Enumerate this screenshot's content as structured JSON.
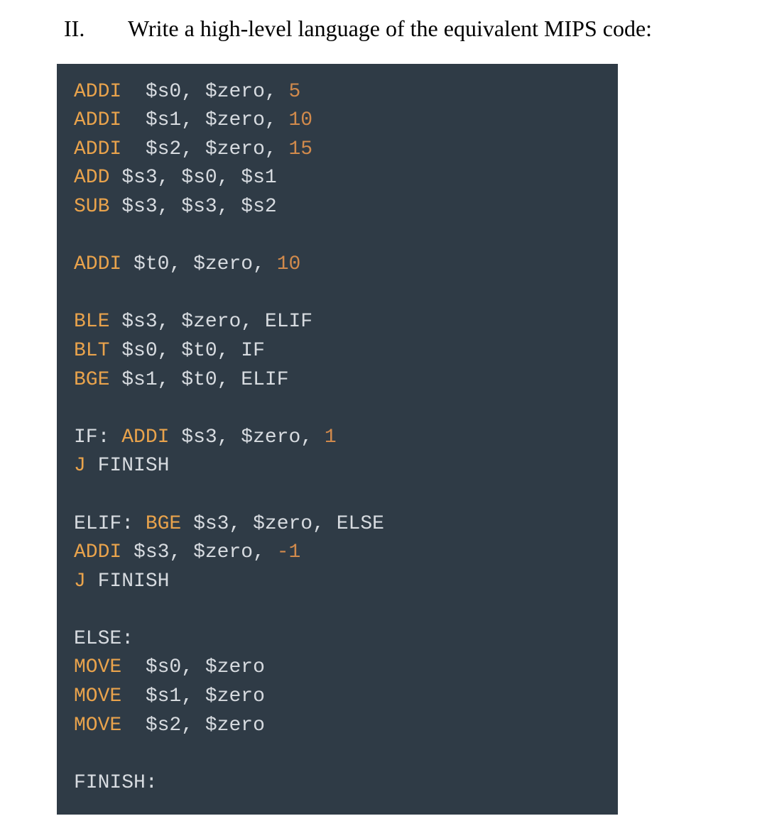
{
  "heading": {
    "number": "II.",
    "text": "Write a high-level language of the equivalent MIPS code:"
  },
  "code": {
    "lines": [
      [
        {
          "t": "op",
          "v": "ADDI"
        },
        {
          "t": "sp",
          "v": "  "
        },
        {
          "t": "reg",
          "v": "$s0"
        },
        {
          "t": "reg",
          "v": ", "
        },
        {
          "t": "reg",
          "v": "$zero"
        },
        {
          "t": "reg",
          "v": ", "
        },
        {
          "t": "num",
          "v": "5"
        }
      ],
      [
        {
          "t": "op",
          "v": "ADDI"
        },
        {
          "t": "sp",
          "v": "  "
        },
        {
          "t": "reg",
          "v": "$s1"
        },
        {
          "t": "reg",
          "v": ", "
        },
        {
          "t": "reg",
          "v": "$zero"
        },
        {
          "t": "reg",
          "v": ", "
        },
        {
          "t": "num",
          "v": "10"
        }
      ],
      [
        {
          "t": "op",
          "v": "ADDI"
        },
        {
          "t": "sp",
          "v": "  "
        },
        {
          "t": "reg",
          "v": "$s2"
        },
        {
          "t": "reg",
          "v": ", "
        },
        {
          "t": "reg",
          "v": "$zero"
        },
        {
          "t": "reg",
          "v": ", "
        },
        {
          "t": "num",
          "v": "15"
        }
      ],
      [
        {
          "t": "op",
          "v": "ADD"
        },
        {
          "t": "sp",
          "v": " "
        },
        {
          "t": "reg",
          "v": "$s3"
        },
        {
          "t": "reg",
          "v": ", "
        },
        {
          "t": "reg",
          "v": "$s0"
        },
        {
          "t": "reg",
          "v": ", "
        },
        {
          "t": "reg",
          "v": "$s1"
        }
      ],
      [
        {
          "t": "op",
          "v": "SUB"
        },
        {
          "t": "sp",
          "v": " "
        },
        {
          "t": "reg",
          "v": "$s3"
        },
        {
          "t": "reg",
          "v": ", "
        },
        {
          "t": "reg",
          "v": "$s3"
        },
        {
          "t": "reg",
          "v": ", "
        },
        {
          "t": "reg",
          "v": "$s2"
        }
      ],
      [],
      [
        {
          "t": "op",
          "v": "ADDI"
        },
        {
          "t": "sp",
          "v": " "
        },
        {
          "t": "reg",
          "v": "$t0"
        },
        {
          "t": "reg",
          "v": ", "
        },
        {
          "t": "reg",
          "v": "$zero"
        },
        {
          "t": "reg",
          "v": ", "
        },
        {
          "t": "num",
          "v": "10"
        }
      ],
      [],
      [
        {
          "t": "op",
          "v": "BLE"
        },
        {
          "t": "sp",
          "v": " "
        },
        {
          "t": "reg",
          "v": "$s3"
        },
        {
          "t": "reg",
          "v": ", "
        },
        {
          "t": "reg",
          "v": "$zero"
        },
        {
          "t": "reg",
          "v": ", "
        },
        {
          "t": "lbl",
          "v": "ELIF"
        }
      ],
      [
        {
          "t": "op",
          "v": "BLT"
        },
        {
          "t": "sp",
          "v": " "
        },
        {
          "t": "reg",
          "v": "$s0"
        },
        {
          "t": "reg",
          "v": ", "
        },
        {
          "t": "reg",
          "v": "$t0"
        },
        {
          "t": "reg",
          "v": ", "
        },
        {
          "t": "lbl",
          "v": "IF"
        }
      ],
      [
        {
          "t": "op",
          "v": "BGE"
        },
        {
          "t": "sp",
          "v": " "
        },
        {
          "t": "reg",
          "v": "$s1"
        },
        {
          "t": "reg",
          "v": ", "
        },
        {
          "t": "reg",
          "v": "$t0"
        },
        {
          "t": "reg",
          "v": ", "
        },
        {
          "t": "lbl",
          "v": "ELIF"
        }
      ],
      [],
      [
        {
          "t": "lbl",
          "v": "IF:"
        },
        {
          "t": "sp",
          "v": " "
        },
        {
          "t": "op",
          "v": "ADDI"
        },
        {
          "t": "sp",
          "v": " "
        },
        {
          "t": "reg",
          "v": "$s3"
        },
        {
          "t": "reg",
          "v": ", "
        },
        {
          "t": "reg",
          "v": "$zero"
        },
        {
          "t": "reg",
          "v": ", "
        },
        {
          "t": "num",
          "v": "1"
        }
      ],
      [
        {
          "t": "op",
          "v": "J"
        },
        {
          "t": "sp",
          "v": " "
        },
        {
          "t": "lbl",
          "v": "FINISH"
        }
      ],
      [],
      [
        {
          "t": "lbl",
          "v": "ELIF:"
        },
        {
          "t": "sp",
          "v": " "
        },
        {
          "t": "op",
          "v": "BGE"
        },
        {
          "t": "sp",
          "v": " "
        },
        {
          "t": "reg",
          "v": "$s3"
        },
        {
          "t": "reg",
          "v": ", "
        },
        {
          "t": "reg",
          "v": "$zero"
        },
        {
          "t": "reg",
          "v": ", "
        },
        {
          "t": "lbl",
          "v": "ELSE"
        }
      ],
      [
        {
          "t": "op",
          "v": "ADDI"
        },
        {
          "t": "sp",
          "v": " "
        },
        {
          "t": "reg",
          "v": "$s3"
        },
        {
          "t": "reg",
          "v": ", "
        },
        {
          "t": "reg",
          "v": "$zero"
        },
        {
          "t": "reg",
          "v": ", "
        },
        {
          "t": "num",
          "v": "-1"
        }
      ],
      [
        {
          "t": "op",
          "v": "J"
        },
        {
          "t": "sp",
          "v": " "
        },
        {
          "t": "lbl",
          "v": "FINISH"
        }
      ],
      [],
      [
        {
          "t": "lbl",
          "v": "ELSE:"
        }
      ],
      [
        {
          "t": "op",
          "v": "MOVE"
        },
        {
          "t": "sp",
          "v": "  "
        },
        {
          "t": "reg",
          "v": "$s0"
        },
        {
          "t": "reg",
          "v": ", "
        },
        {
          "t": "reg",
          "v": "$zero"
        }
      ],
      [
        {
          "t": "op",
          "v": "MOVE"
        },
        {
          "t": "sp",
          "v": "  "
        },
        {
          "t": "reg",
          "v": "$s1"
        },
        {
          "t": "reg",
          "v": ", "
        },
        {
          "t": "reg",
          "v": "$zero"
        }
      ],
      [
        {
          "t": "op",
          "v": "MOVE"
        },
        {
          "t": "sp",
          "v": "  "
        },
        {
          "t": "reg",
          "v": "$s2"
        },
        {
          "t": "reg",
          "v": ", "
        },
        {
          "t": "reg",
          "v": "$zero"
        }
      ],
      [],
      [
        {
          "t": "lbl",
          "v": "FINISH:"
        }
      ]
    ]
  }
}
